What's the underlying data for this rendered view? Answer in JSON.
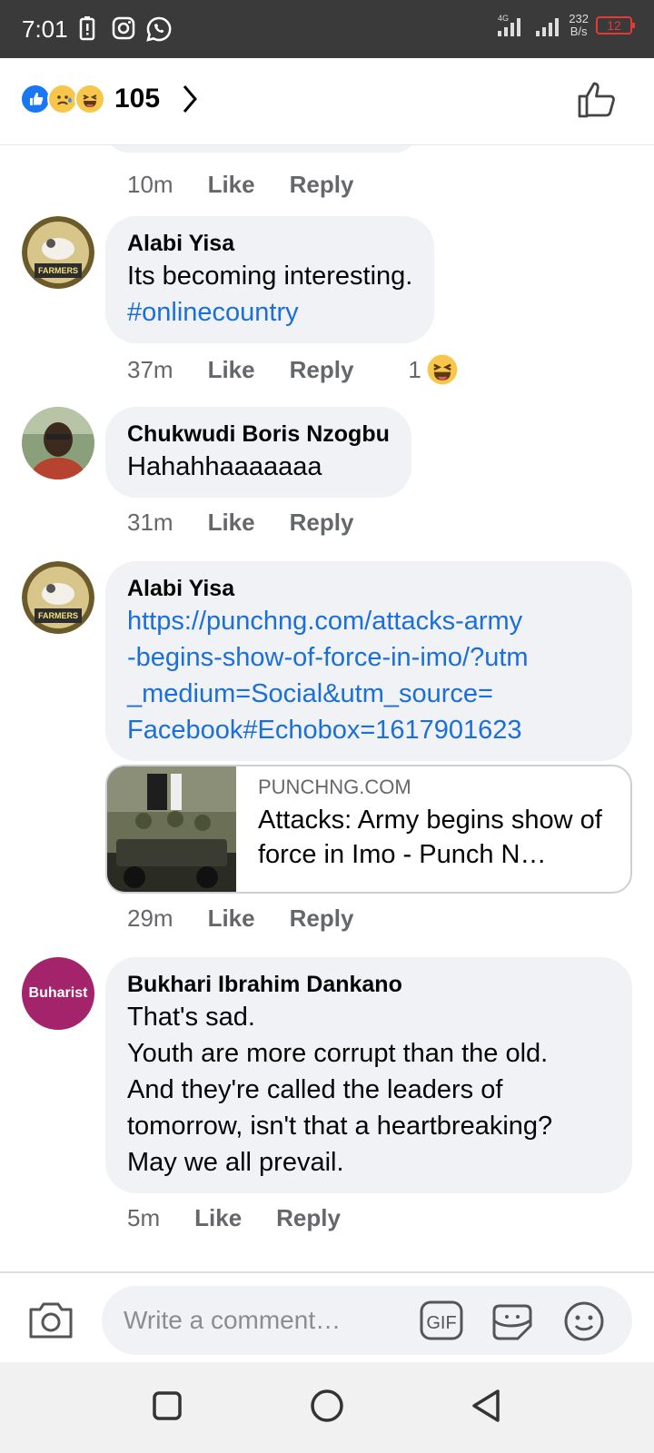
{
  "status_bar": {
    "time": "7:01",
    "net": "4G",
    "speed_value": "232",
    "speed_unit": "B/s",
    "battery": "12"
  },
  "reactions": {
    "count": "105",
    "icons": [
      "like-icon",
      "sad-icon",
      "haha-icon"
    ]
  },
  "comments": [
    {
      "time": "10m",
      "like": "Like",
      "reply": "Reply"
    },
    {
      "author": "Alabi Yisa",
      "text": "Its becoming interesting.",
      "hashtag": "#onlinecountry",
      "time": "37m",
      "like": "Like",
      "reply": "Reply",
      "reaction_count": "1"
    },
    {
      "author": "Chukwudi Boris Nzogbu",
      "text": "Hahahhaaaaaaa",
      "time": "31m",
      "like": "Like",
      "reply": "Reply"
    },
    {
      "author": "Alabi Yisa",
      "link": "https://punchng.com/attacks-army\n-begins-show-of-force-in-imo/?utm\n_medium=Social&utm_source=\nFacebook#Echobox=1617901623",
      "preview_domain": "PUNCHNG.COM",
      "preview_title": "Attacks: Army begins show of force in Imo - Punch N…",
      "time": "29m",
      "like": "Like",
      "reply": "Reply"
    },
    {
      "author": "Bukhari Ibrahim Dankano",
      "avatar_text": "Buharist",
      "text": "That's sad.\nYouth are more corrupt than the old.\nAnd they're called the leaders of\ntomorrow, isn't that a heartbreaking?\nMay we all prevail.",
      "time": "5m",
      "like": "Like",
      "reply": "Reply"
    }
  ],
  "composer": {
    "placeholder": "Write a comment…",
    "gif": "GIF"
  },
  "colors": {
    "link": "#1a6fd8",
    "bubble": "#f0f2f5",
    "accent": "#1877f2",
    "avatar_buharist": "#a3246a"
  }
}
